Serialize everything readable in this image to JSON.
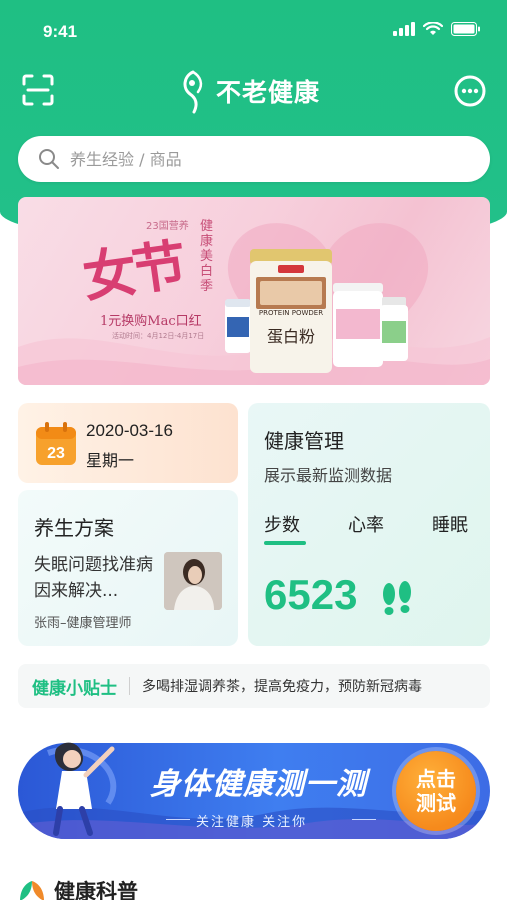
{
  "status_bar": {
    "time": "9:41"
  },
  "nav": {
    "brand": "不老健康"
  },
  "search": {
    "placeholder": "养生经验 / 商品"
  },
  "banner": {
    "small_text": "23国营养",
    "big_text": "女节",
    "vertical_text": "健康美白季",
    "offer": "1元换购Mac口红",
    "date": "活动时间：4月12日-4月17日",
    "product_label": "蛋白粉",
    "product_en": "PROTEIN POWDER"
  },
  "date_card": {
    "date": "2020-03-16",
    "weekday": "星期一",
    "calendar_day": "23"
  },
  "plan_card": {
    "title": "养生方案",
    "desc": "失眠问题找准病因来解决...",
    "author": "张雨–健康管理师"
  },
  "health_card": {
    "title": "健康管理",
    "subtitle": "展示最新监测数据",
    "tabs": [
      "步数",
      "心率",
      "睡眠"
    ],
    "active_tab": 0,
    "steps": "6523"
  },
  "tips": {
    "label": "健康小贴士",
    "text": "多喝排湿调养茶，提高免疫力，预防新冠病毒"
  },
  "test_banner": {
    "title": "身体健康测一测",
    "subtitle": "关注健康 关注你",
    "button_line1": "点击",
    "button_line2": "测试"
  },
  "science": {
    "title": "健康科普"
  },
  "colors": {
    "brand_green": "#1fbf83",
    "banner_pink": "#f7cfdc",
    "test_blue": "#3f7ef0",
    "test_orange": "#f68a1c"
  }
}
